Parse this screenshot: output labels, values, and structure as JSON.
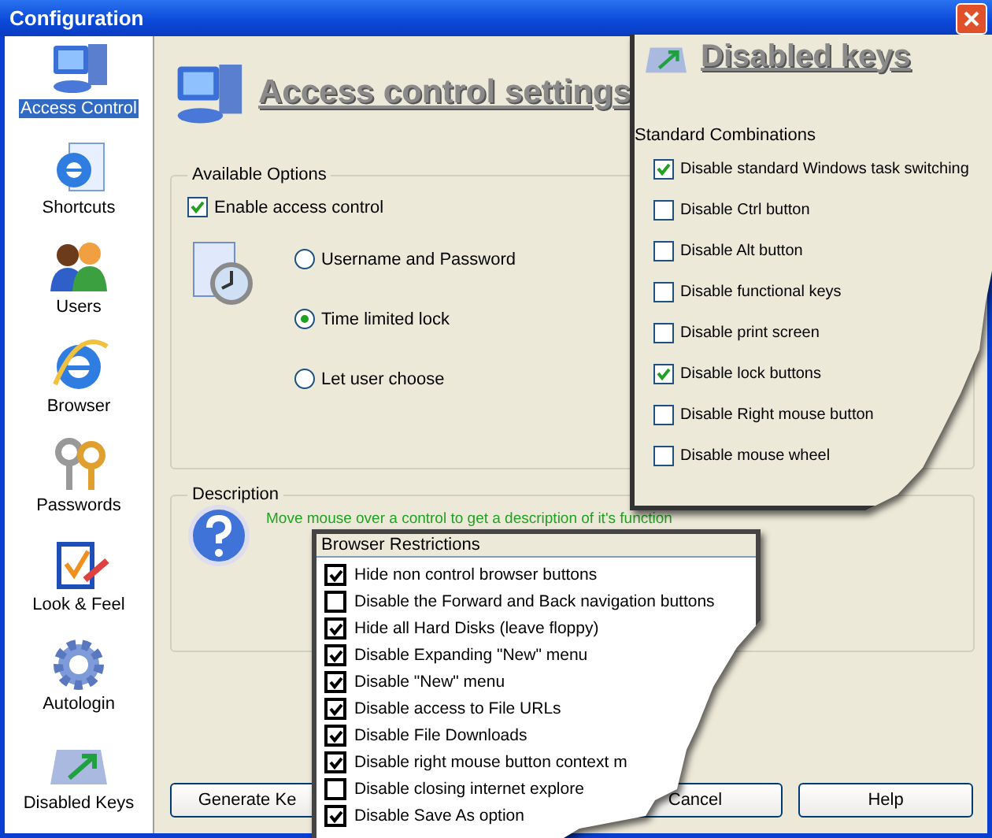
{
  "window": {
    "title": "Configuration"
  },
  "sidebar": {
    "items": [
      {
        "label": "Access Control",
        "selected": true
      },
      {
        "label": "Shortcuts",
        "selected": false
      },
      {
        "label": "Users",
        "selected": false
      },
      {
        "label": "Browser",
        "selected": false
      },
      {
        "label": "Passwords",
        "selected": false
      },
      {
        "label": "Look & Feel",
        "selected": false
      },
      {
        "label": "Autologin",
        "selected": false
      },
      {
        "label": "Disabled Keys",
        "selected": false
      }
    ]
  },
  "page": {
    "title": "Access control settings"
  },
  "available_options": {
    "legend": "Available Options",
    "enable": {
      "label": "Enable access control",
      "checked": true
    },
    "modes": [
      {
        "label": "Username and Password",
        "selected": false
      },
      {
        "label": "Time limited lock",
        "selected": true
      },
      {
        "label": "Let user choose",
        "selected": false
      }
    ]
  },
  "description": {
    "legend": "Description",
    "text": "Move mouse over a control to get a description of it's function"
  },
  "buttons": [
    "Generate Ke",
    "Cancel",
    "Help"
  ],
  "disabled_keys_panel": {
    "title": "Disabled keys",
    "legend": "Standard Combinations",
    "options": [
      {
        "label": "Disable standard Windows task switching",
        "checked": true
      },
      {
        "label": "Disable Ctrl button",
        "checked": false
      },
      {
        "label": "Disable Alt button",
        "checked": false
      },
      {
        "label": "Disable functional keys",
        "checked": false
      },
      {
        "label": "Disable print screen",
        "checked": false
      },
      {
        "label": "Disable lock buttons",
        "checked": true
      },
      {
        "label": "Disable Right mouse button",
        "checked": false
      },
      {
        "label": "Disable mouse wheel",
        "checked": false
      }
    ]
  },
  "browser_restrictions_panel": {
    "legend": "Browser Restrictions",
    "options": [
      {
        "label": "Hide non control browser buttons",
        "checked": true
      },
      {
        "label": "Disable the Forward and Back navigation buttons",
        "checked": false
      },
      {
        "label": "Hide all Hard Disks (leave floppy)",
        "checked": true
      },
      {
        "label": "Disable Expanding \"New\" menu",
        "checked": true
      },
      {
        "label": "Disable \"New\" menu",
        "checked": true
      },
      {
        "label": "Disable access to File URLs",
        "checked": true
      },
      {
        "label": "Disable File Downloads",
        "checked": true
      },
      {
        "label": "Disable right mouse button context m",
        "checked": true
      },
      {
        "label": "Disable closing internet explore",
        "checked": false
      },
      {
        "label": "Disable Save As option",
        "checked": true
      }
    ]
  }
}
